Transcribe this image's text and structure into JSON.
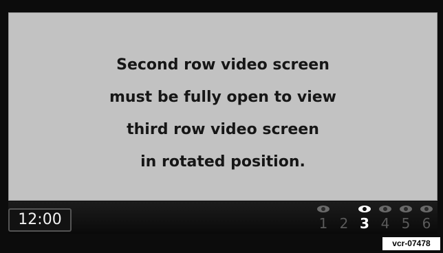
{
  "message": {
    "lines": [
      "Second row video screen",
      "must be fully open to view",
      "third row video screen",
      "in rotated position."
    ]
  },
  "status_bar": {
    "clock": "12:00",
    "channels": [
      {
        "number": "1",
        "icon": "eye-icon",
        "active": false,
        "icon_visible": true
      },
      {
        "number": "2",
        "icon": "eye-icon",
        "active": false,
        "icon_visible": false
      },
      {
        "number": "3",
        "icon": "eye-icon",
        "active": true,
        "icon_visible": true
      },
      {
        "number": "4",
        "icon": "eye-icon",
        "active": false,
        "icon_visible": true
      },
      {
        "number": "5",
        "icon": "eye-icon",
        "active": false,
        "icon_visible": true
      },
      {
        "number": "6",
        "icon": "eye-icon",
        "active": false,
        "icon_visible": true
      }
    ]
  },
  "reference_tag": "vcr-07478",
  "colors": {
    "panel": "#c2c2c2",
    "frame": "#0c0c0c",
    "text": "#161616",
    "active_channel": "#ffffff",
    "inactive_channel": "#5a5a5a"
  }
}
